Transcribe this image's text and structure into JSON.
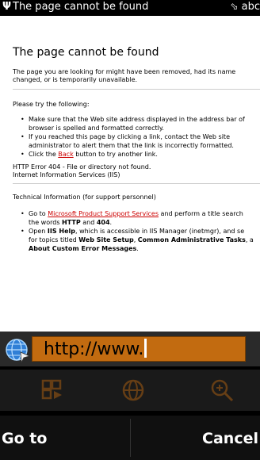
{
  "status_bar": {
    "signal": "Ψ",
    "title": "The page cannot be found",
    "input_mode": "abc"
  },
  "page": {
    "heading": "The page cannot be found",
    "intro_line1": "The page you are looking for might have been removed, had its name",
    "intro_line2": "changed, or is temporarily unavailable.",
    "try_heading": "Please try the following:",
    "bullet1_line1": "Make sure that the Web site address displayed in the address bar of",
    "bullet1_line2": "browser is spelled and formatted correctly.",
    "bullet2_line1": "If you reached this page by clicking a link, contact the Web site",
    "bullet2_line2": "administrator to alert them that the link is incorrectly formatted.",
    "bullet3_prefix": "Click the ",
    "bullet3_link": "Back",
    "bullet3_suffix": " button to try another link.",
    "error_line1": "HTTP Error 404 - File or directory not found.",
    "error_line2": "Internet Information Services (IIS)",
    "tech_heading": "Technical Information (for support personnel)",
    "tech1_prefix": "Go to ",
    "tech1_link": "Microsoft Product Support Services",
    "tech1_suffix": " and perform a title search",
    "tech1_line2_prefix": "the words ",
    "tech1_bold1": "HTTP",
    "tech1_and": " and ",
    "tech1_bold2": "404",
    "tech1_end": ".",
    "tech2_prefix": "Open ",
    "tech2_bold": "IIS Help",
    "tech2_suffix": ", which is accessible in IIS Manager (inetmgr), and se",
    "tech2_line2_prefix": "for topics titled ",
    "tech2_bold2": "Web Site Setup",
    "tech2_comma": ", ",
    "tech2_bold3": "Common Administrative Tasks",
    "tech2_line2_end": ", a",
    "tech2_bold4": "About Custom Error Messages",
    "tech2_end": "."
  },
  "address_bar": {
    "value": "http://www.",
    "icon": "globe-icon"
  },
  "toolbar": {
    "icons": [
      "grid-view-icon",
      "globe-icon",
      "zoom-in-icon"
    ]
  },
  "softkeys": {
    "left": "Go to",
    "right": "Cancel"
  },
  "colors": {
    "url_field": "#c26b10",
    "link": "#cc0000"
  }
}
